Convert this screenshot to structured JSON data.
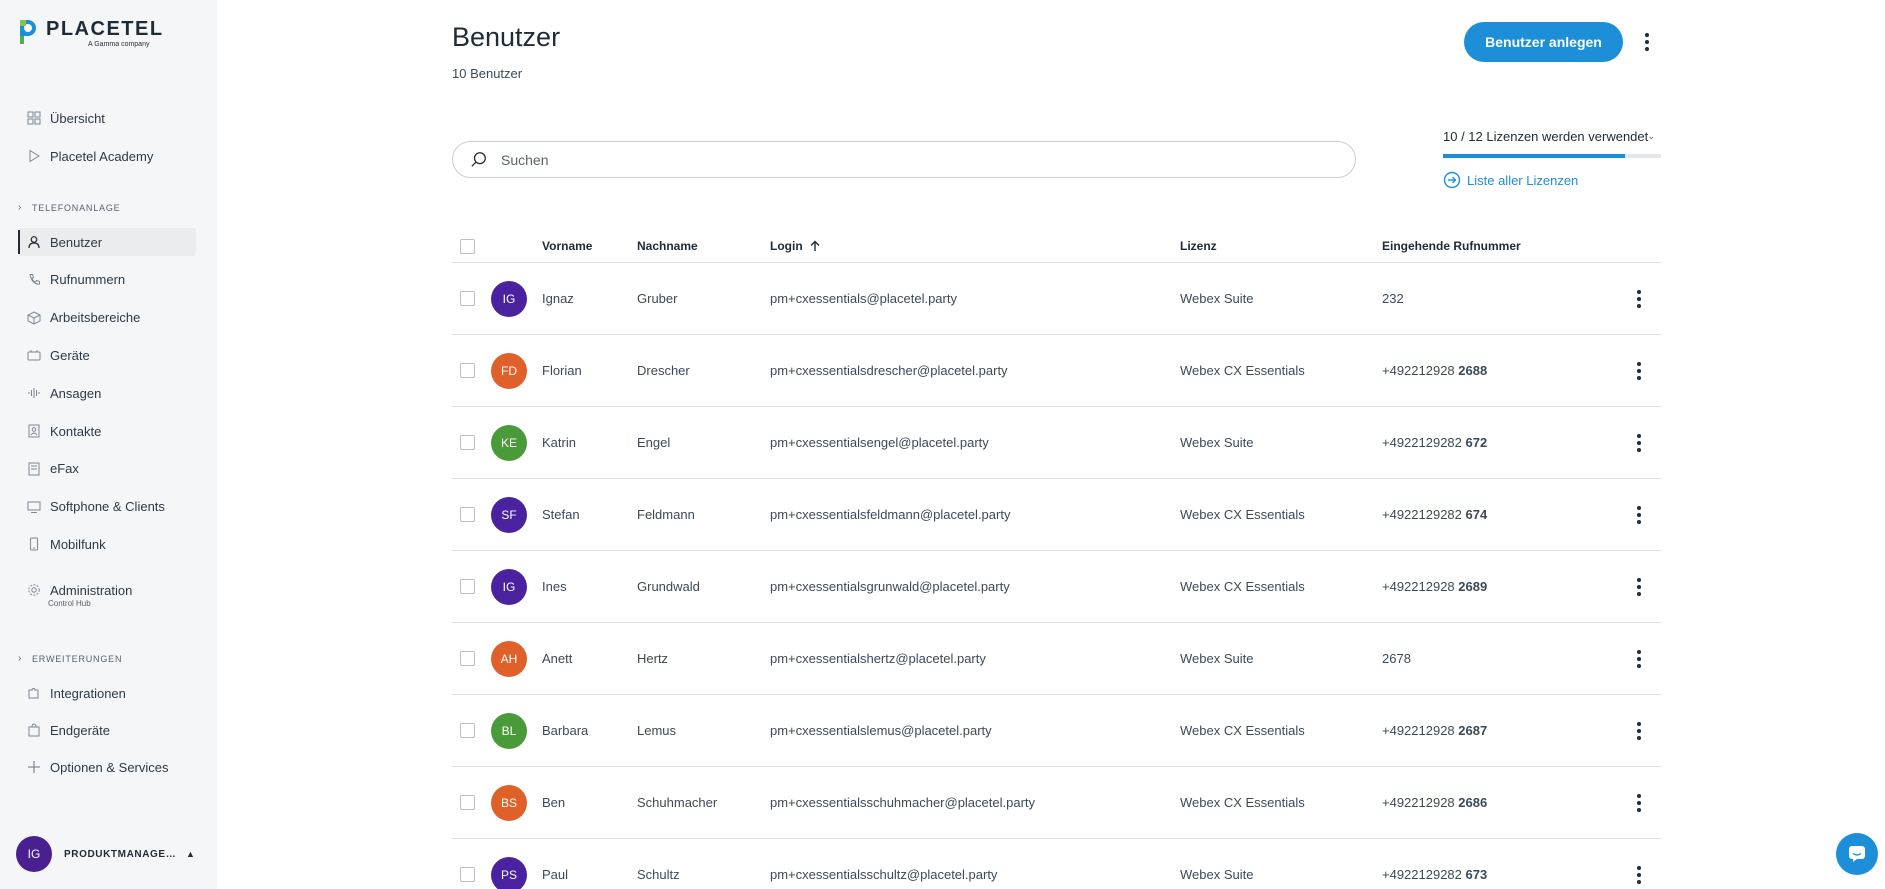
{
  "brand": {
    "name": "PLACETEL",
    "tagline": "A Gamma company",
    "accent": "#1c8fd8"
  },
  "sidebar": {
    "top_items": [
      {
        "label": "Übersicht",
        "icon": "grid-icon"
      },
      {
        "label": "Placetel Academy",
        "icon": "play-icon"
      }
    ],
    "section_telefonanlage": "TELEFONANLAGE",
    "telefon_items": [
      {
        "label": "Benutzer",
        "icon": "user-icon",
        "active": true
      },
      {
        "label": "Rufnummern",
        "icon": "phone-icon"
      },
      {
        "label": "Arbeitsbereiche",
        "icon": "cube-icon"
      },
      {
        "label": "Geräte",
        "icon": "device-icon"
      },
      {
        "label": "Ansagen",
        "icon": "audio-wave-icon"
      },
      {
        "label": "Kontakte",
        "icon": "contact-book-icon"
      },
      {
        "label": "eFax",
        "icon": "fax-icon"
      },
      {
        "label": "Softphone & Clients",
        "icon": "desktop-icon"
      },
      {
        "label": "Mobilfunk",
        "icon": "mobile-icon"
      }
    ],
    "administration": {
      "label": "Administration",
      "sub": "Control Hub",
      "icon": "gear-icon"
    },
    "section_erweiterungen": "ERWEITERUNGEN",
    "erweiterung_items": [
      {
        "label": "Integrationen",
        "icon": "puzzle-icon"
      },
      {
        "label": "Endgeräte",
        "icon": "shopping-bag-icon"
      },
      {
        "label": "Optionen & Services",
        "icon": "plus-icon"
      }
    ],
    "account": {
      "initials": "IG",
      "name": "PRODUKTMANAGEMENT"
    }
  },
  "header": {
    "title": "Benutzer",
    "count": "10 Benutzer",
    "create_button": "Benutzer anlegen"
  },
  "search": {
    "placeholder": "Suchen",
    "value": ""
  },
  "licenses": {
    "label": "10 / 12 Lizenzen werden verwendet",
    "used": 10,
    "total": 12,
    "link": "Liste aller Lizenzen"
  },
  "table": {
    "columns": {
      "firstname": "Vorname",
      "lastname": "Nachname",
      "login": "Login",
      "license": "Lizenz",
      "incoming": "Eingehende Rufnummer"
    },
    "sort_column": "Login",
    "rows": [
      {
        "initials": "IG",
        "color": "#4a22a0",
        "firstname": "Ignaz",
        "lastname": "Gruber",
        "login": "pm+cxessentials@placetel.party",
        "license": "Webex Suite",
        "number_prefix": "232",
        "number_ext": ""
      },
      {
        "initials": "FD",
        "color": "#e0602a",
        "firstname": "Florian",
        "lastname": "Drescher",
        "login": "pm+cxessentialsdrescher@placetel.party",
        "license": "Webex CX Essentials",
        "number_prefix": "+492212928 ",
        "number_ext": "2688"
      },
      {
        "initials": "KE",
        "color": "#4a9a3a",
        "firstname": "Katrin",
        "lastname": "Engel",
        "login": "pm+cxessentialsengel@placetel.party",
        "license": "Webex Suite",
        "number_prefix": "+4922129282 ",
        "number_ext": "672"
      },
      {
        "initials": "SF",
        "color": "#4a22a0",
        "firstname": "Stefan",
        "lastname": "Feldmann",
        "login": "pm+cxessentialsfeldmann@placetel.party",
        "license": "Webex CX Essentials",
        "number_prefix": "+4922129282 ",
        "number_ext": "674"
      },
      {
        "initials": "IG",
        "color": "#4a22a0",
        "firstname": "Ines",
        "lastname": "Grundwald",
        "login": "pm+cxessentialsgrunwald@placetel.party",
        "license": "Webex CX Essentials",
        "number_prefix": "+492212928 ",
        "number_ext": "2689"
      },
      {
        "initials": "AH",
        "color": "#e0602a",
        "firstname": "Anett",
        "lastname": "Hertz",
        "login": "pm+cxessentialshertz@placetel.party",
        "license": "Webex Suite",
        "number_prefix": "2678",
        "number_ext": ""
      },
      {
        "initials": "BL",
        "color": "#4a9a3a",
        "firstname": "Barbara",
        "lastname": "Lemus",
        "login": "pm+cxessentialslemus@placetel.party",
        "license": "Webex CX Essentials",
        "number_prefix": "+492212928 ",
        "number_ext": "2687"
      },
      {
        "initials": "BS",
        "color": "#e0602a",
        "firstname": "Ben",
        "lastname": "Schuhmacher",
        "login": "pm+cxessentialsschuhmacher@placetel.party",
        "license": "Webex CX Essentials",
        "number_prefix": "+492212928 ",
        "number_ext": "2686"
      },
      {
        "initials": "PS",
        "color": "#4a22a0",
        "firstname": "Paul",
        "lastname": "Schultz",
        "login": "pm+cxessentialsschultz@placetel.party",
        "license": "Webex Suite",
        "number_prefix": "+4922129282 ",
        "number_ext": "673"
      }
    ]
  }
}
